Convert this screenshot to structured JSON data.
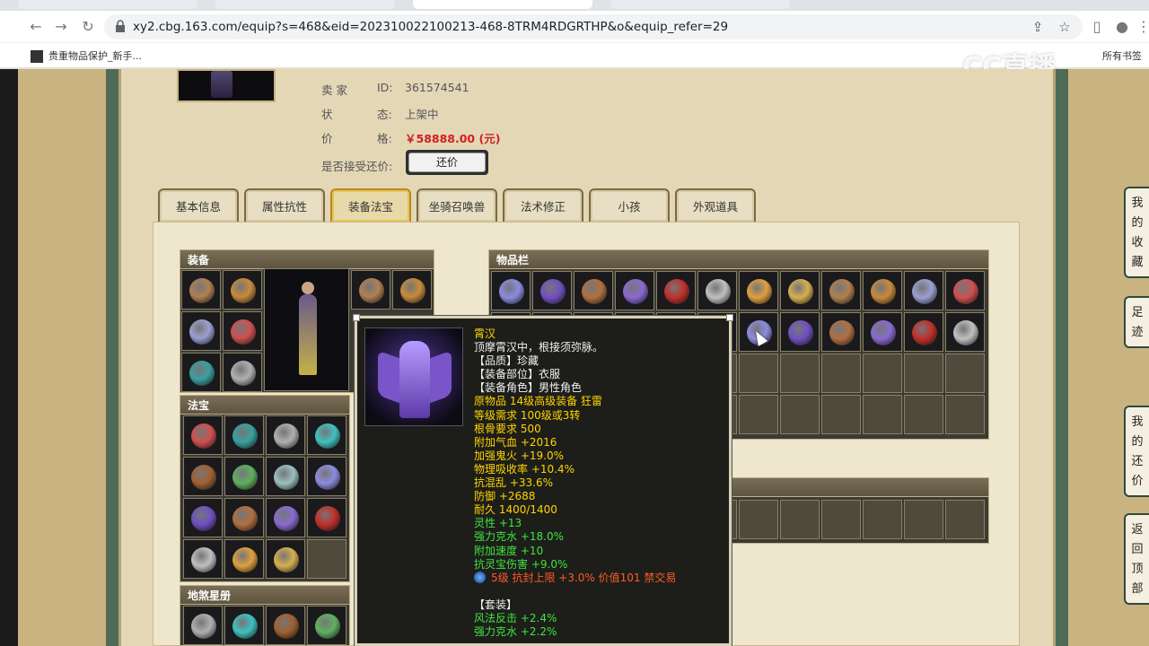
{
  "browser": {
    "url": "xy2.cbg.163.com/equip?s=468&eid=202310022100213-468-8TRM4RDGRTHP&o&equip_refer=29",
    "bookmark_label": "贵重物品保护_新手...",
    "bookmark_right": "所有书签"
  },
  "watermark": "CC直播",
  "seller": {
    "seller_label": "卖 家",
    "id_label": "ID:",
    "id_value": "361574541",
    "status_label": "状",
    "status_label2": "态:",
    "status_value": "上架中",
    "price_label": "价",
    "price_label2": "格:",
    "price_value": "￥58888.00 (元)",
    "counter_label": "是否接受还价:",
    "counter_button": "还价"
  },
  "tabs": [
    "基本信息",
    "属性抗性",
    "装备法宝",
    "坐骑召唤兽",
    "法术修正",
    "小孩",
    "外观道具"
  ],
  "active_tab": 2,
  "panels": {
    "equipment": "装备",
    "magic_treasure": "法宝",
    "inventory": "物品栏",
    "earth_star": "地煞星册"
  },
  "tooltip": {
    "name": "霄汉",
    "desc": "顶摩霄汉中，根接须弥脉。",
    "lines": [
      {
        "text": "【品质】珍藏",
        "color": "white"
      },
      {
        "text": "【装备部位】衣服",
        "color": "white"
      },
      {
        "text": "【装备角色】男性角色",
        "color": "white"
      },
      {
        "text": "原物品 14级高级装备 狂雷",
        "color": "yellow"
      },
      {
        "text": "等级需求 100级或3转",
        "color": "yellow"
      },
      {
        "text": "根骨要求 500",
        "color": "yellow"
      },
      {
        "text": "附加气血 +2016",
        "color": "yellow"
      },
      {
        "text": "加强鬼火 +19.0%",
        "color": "yellow"
      },
      {
        "text": "物理吸收率 +10.4%",
        "color": "yellow"
      },
      {
        "text": "抗混乱 +33.6%",
        "color": "yellow"
      },
      {
        "text": "防御 +2688",
        "color": "yellow"
      },
      {
        "text": "耐久 1400/1400",
        "color": "yellow"
      },
      {
        "text": "灵性 +13",
        "color": "green"
      },
      {
        "text": "强力克水 +18.0%",
        "color": "green"
      },
      {
        "text": "附加速度 +10",
        "color": "green"
      },
      {
        "text": "抗灵宝伤害 +9.0%",
        "color": "green"
      }
    ],
    "gem_line": "5级 抗封上限 +3.0% 价值101 禁交易",
    "set_title": "【套装】",
    "set_lines": [
      "风法反击 +2.4%",
      "强力克水 +2.2%"
    ]
  },
  "side_buttons": [
    {
      "chars": [
        "我",
        "的",
        "收",
        "藏"
      ]
    },
    {
      "chars": [
        "足",
        "迹"
      ]
    },
    {
      "chars": [
        "我",
        "的",
        "还",
        "价"
      ]
    },
    {
      "chars": [
        "返",
        "回",
        "顶",
        "部"
      ]
    }
  ],
  "colors": {
    "price": "#d21f1f",
    "tooltip_yellow": "#ffd400",
    "tooltip_green": "#3fe53f",
    "tooltip_red": "#ff5a28",
    "panel_head": "#6b614a"
  }
}
